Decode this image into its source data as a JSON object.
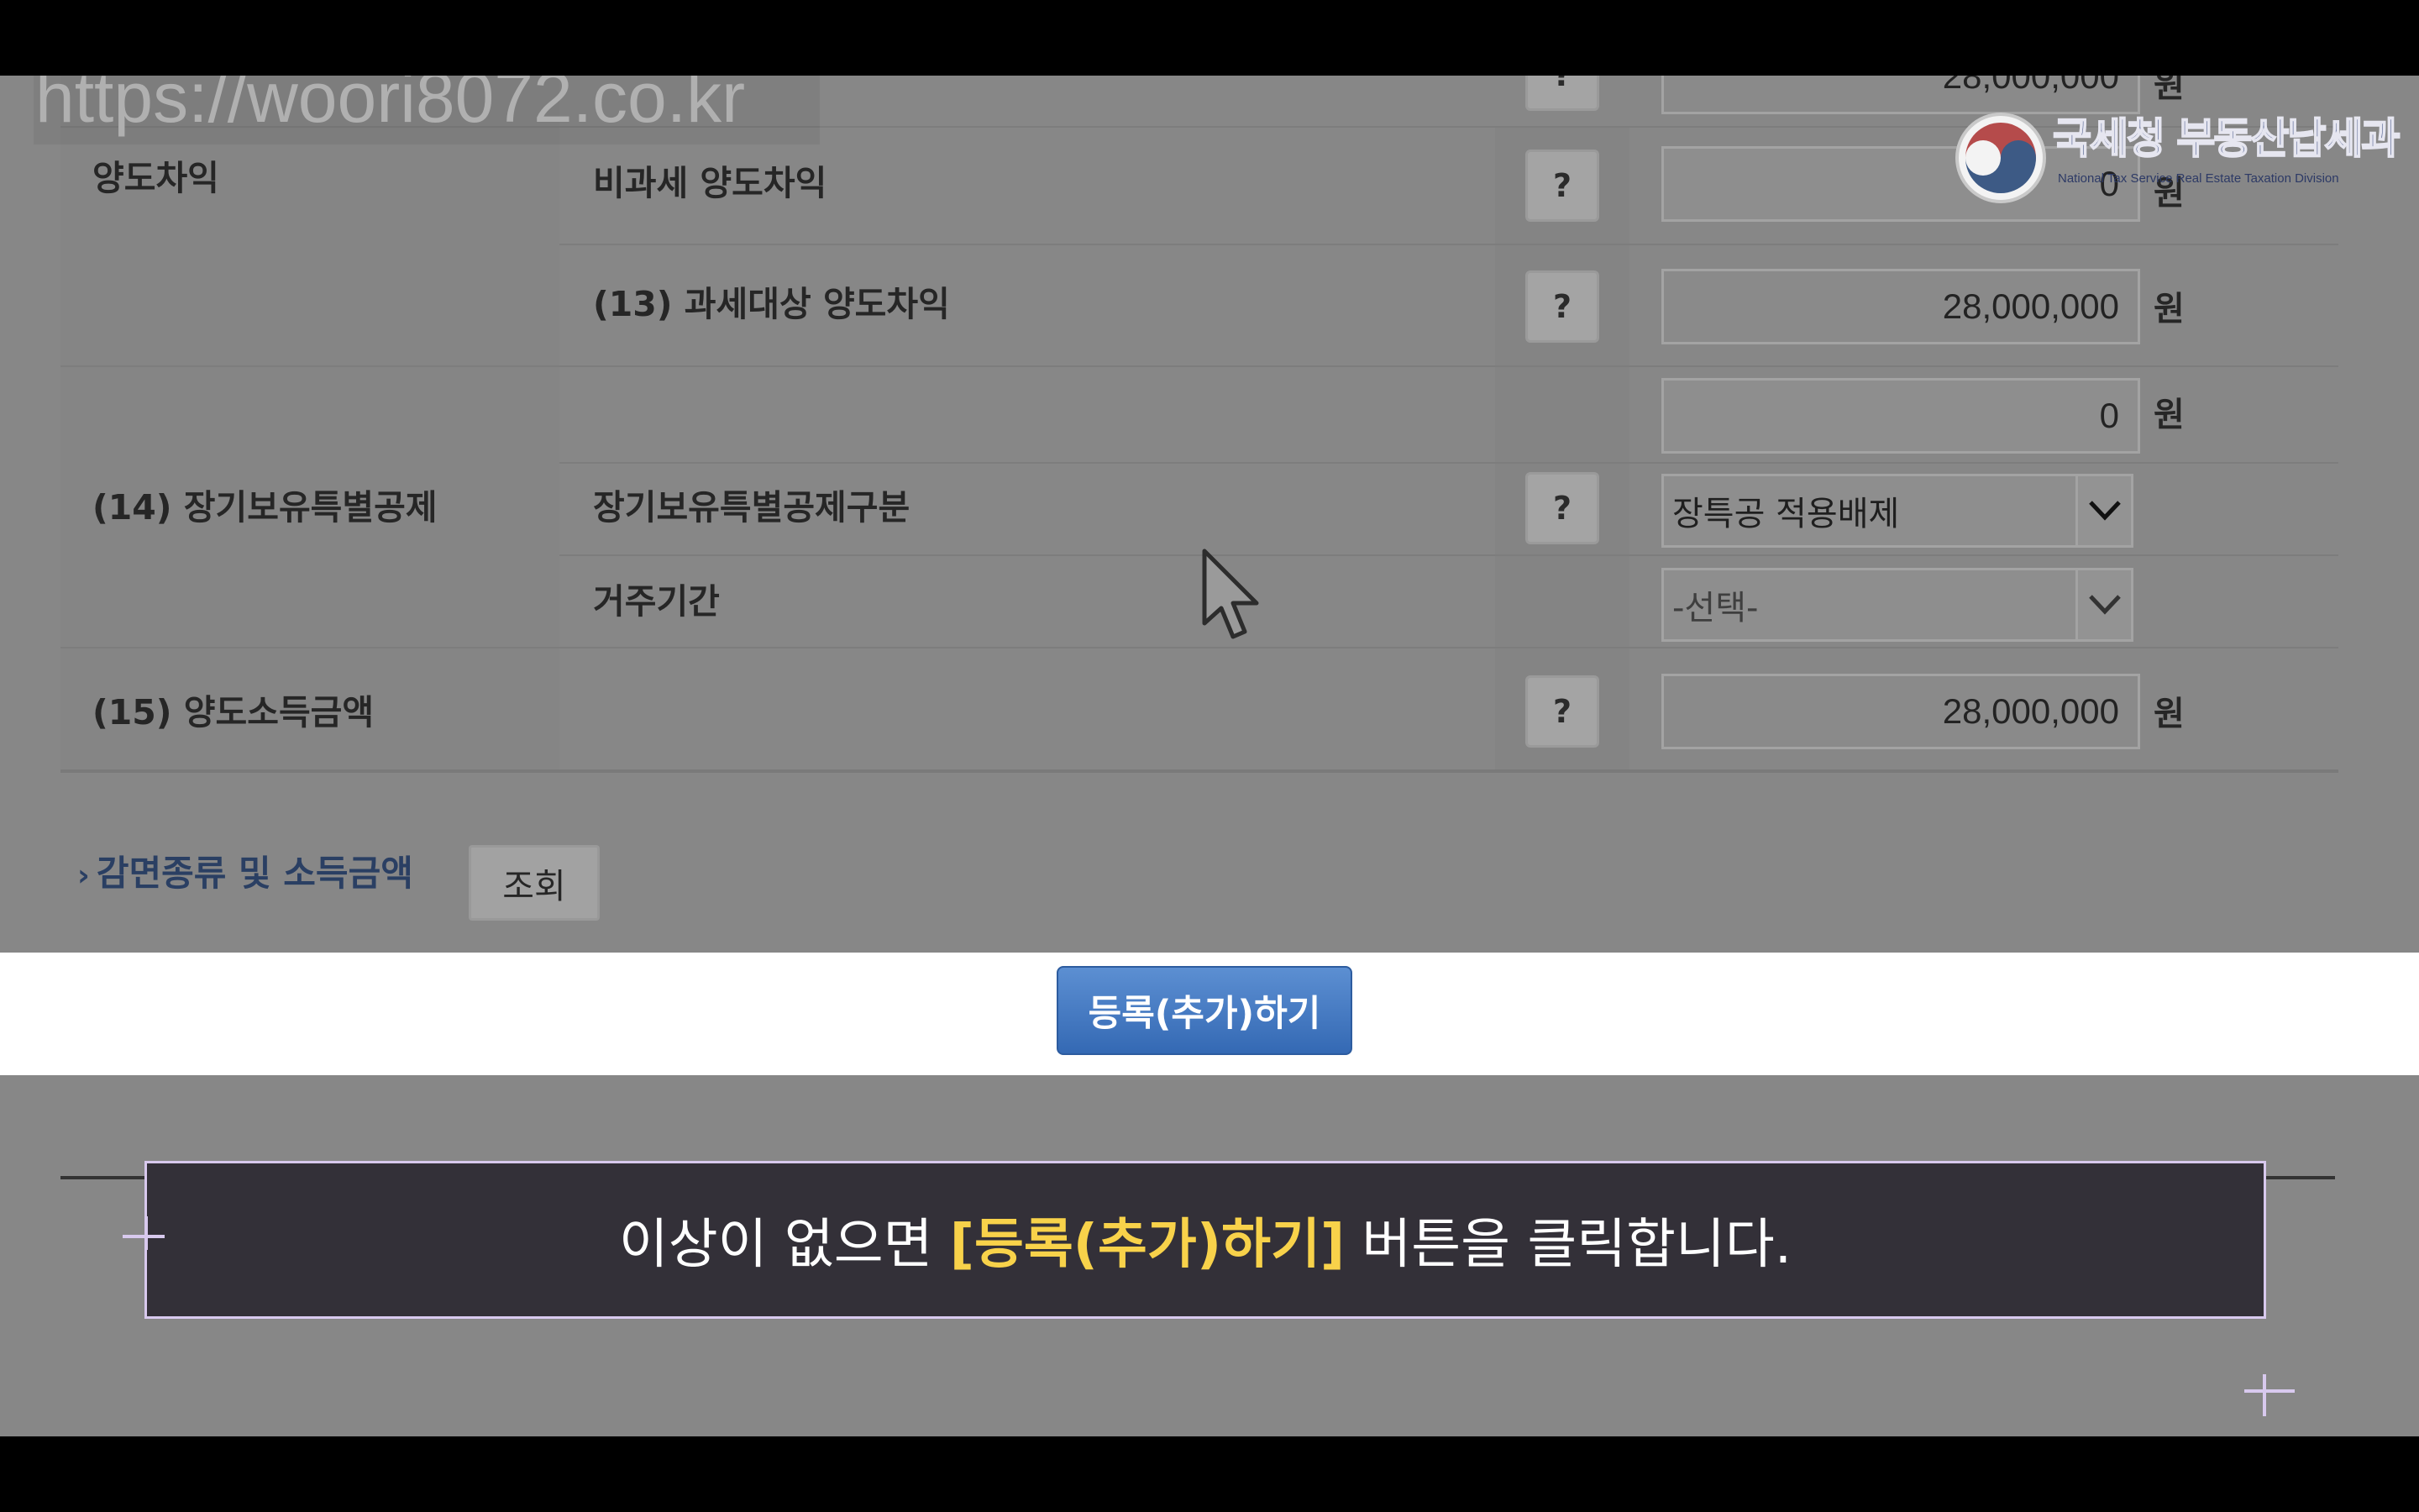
{
  "watermark": "https://woori8072.co.kr",
  "logo": {
    "title": "국세청 부동산납세과",
    "subtitle": "National Tax Service Real Estate Taxation Division"
  },
  "form": {
    "top_partial_value": "28,000,000",
    "unit": "원",
    "help": "?",
    "gain_section_label": "양도차익",
    "nontaxable_gain_label": "비과세 양도차익",
    "nontaxable_gain_value": "0",
    "taxable_gain_label": "(13) 과세대상 양도차익",
    "taxable_gain_value": "28,000,000",
    "ltsd_label": "(14) 장기보유특별공제",
    "ltsd_amount_value": "0",
    "ltsd_type_label": "장기보유특별공제구분",
    "ltsd_type_selected": "장특공 적용배제",
    "residence_period_label": "거주기간",
    "residence_period_selected": "-선택-",
    "income_label": "(15) 양도소득금액",
    "income_value": "28,000,000",
    "reduction_link": "감면종류 및 소득금액",
    "lookup_button": "조회"
  },
  "register_button": "등록(추가)하기",
  "subtitle": {
    "before": "이상이 없으면 ",
    "highlight": "[등록(추가)하기]",
    "after": " 버튼을 클릭합니다."
  }
}
